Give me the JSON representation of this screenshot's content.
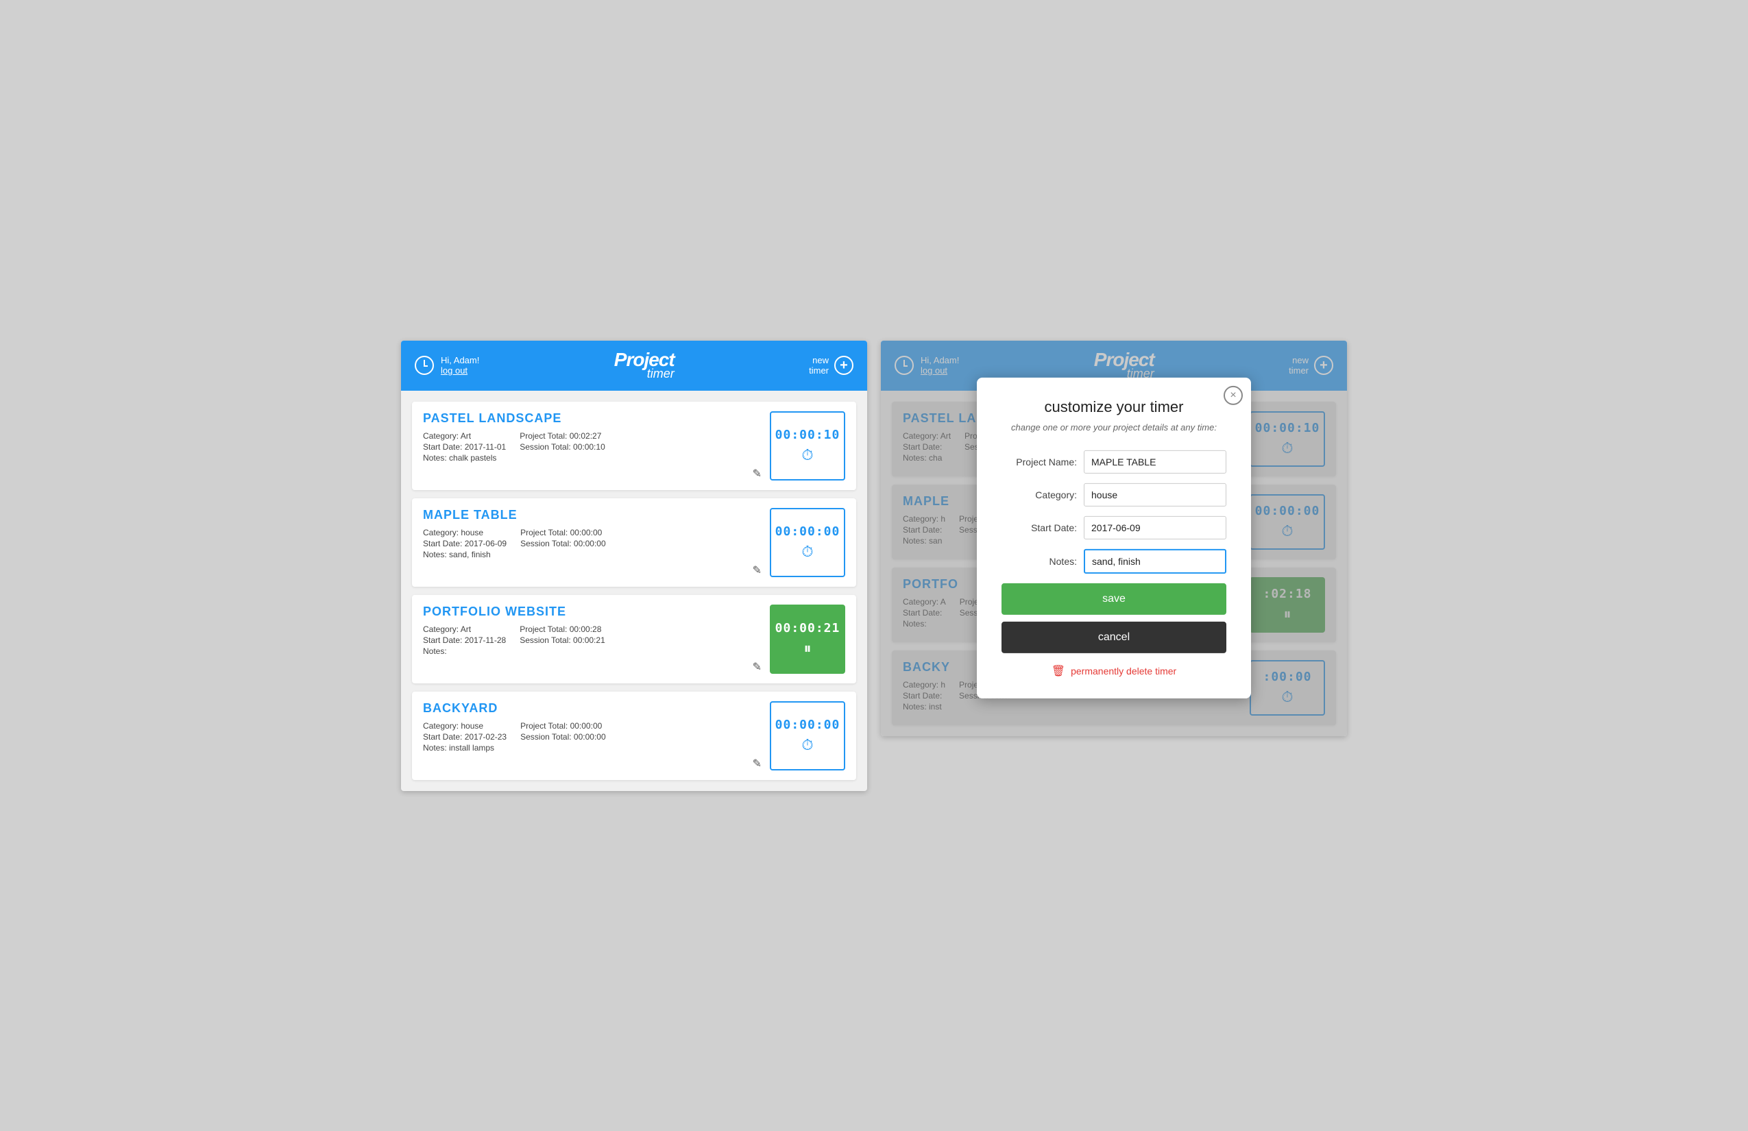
{
  "app": {
    "greeting": "Hi, Adam!\nlog out",
    "greeting_line1": "Hi, Adam!",
    "greeting_line2": "log out",
    "logo_project": "Project",
    "logo_timer": "timer",
    "new_timer_label": "new\ntimer",
    "new_timer_line1": "new",
    "new_timer_line2": "timer"
  },
  "projects": [
    {
      "title": "PASTEL LANDSCAPE",
      "category": "Art",
      "start_date": "2017-11-01",
      "notes": "chalk pastels",
      "project_total": "00:02:27",
      "session_total": "00:00:10",
      "timer_display": "00:00:10",
      "running": false
    },
    {
      "title": "MAPLE TABLE",
      "category": "house",
      "start_date": "2017-06-09",
      "notes": "sand, finish",
      "project_total": "00:00:00",
      "session_total": "00:00:00",
      "timer_display": "00:00:00",
      "running": false
    },
    {
      "title": "PORTFOLIO WEBSITE",
      "category": "Art",
      "start_date": "2017-11-28",
      "notes": "",
      "project_total": "00:00:28",
      "session_total": "00:00:21",
      "timer_display": "00:00:21",
      "running": true
    },
    {
      "title": "BACKYARD",
      "category": "house",
      "start_date": "2017-02-23",
      "notes": "install lamps",
      "project_total": "00:00:00",
      "session_total": "00:00:00",
      "timer_display": "00:00:00",
      "running": false
    }
  ],
  "modal": {
    "title": "customize your timer",
    "subtitle": "change one or more your project details at any time:",
    "close_label": "×",
    "project_name_label": "Project Name:",
    "project_name_value": "MAPLE TABLE",
    "category_label": "Category:",
    "category_value": "house",
    "start_date_label": "Start Date:",
    "start_date_value": "2017-06-09",
    "notes_label": "Notes:",
    "notes_value": "sand, finish",
    "save_label": "save",
    "cancel_label": "cancel",
    "delete_label": "permanently delete timer"
  },
  "right_screen_projects": [
    {
      "title": "PASTEL LANDSCAPE",
      "category": "Art",
      "start_date": "",
      "notes": "cha",
      "project_total": "00:02:27",
      "session_total": "",
      "timer_display": "00:00:10",
      "running": false
    },
    {
      "title": "MAPLE",
      "category": "h",
      "start_date": "",
      "notes": "san",
      "project_total": "",
      "session_total": "",
      "timer_display": "00:00:00",
      "running": false
    },
    {
      "title": "PORTFO",
      "category": "A",
      "start_date": "",
      "notes": "",
      "project_total": "",
      "session_total": "",
      "timer_display": ":02:18",
      "running": true
    },
    {
      "title": "BACKY",
      "category": "h",
      "start_date": "",
      "notes": "inst",
      "project_total": "",
      "session_total": "",
      "timer_display": ":00:00",
      "running": false
    }
  ]
}
